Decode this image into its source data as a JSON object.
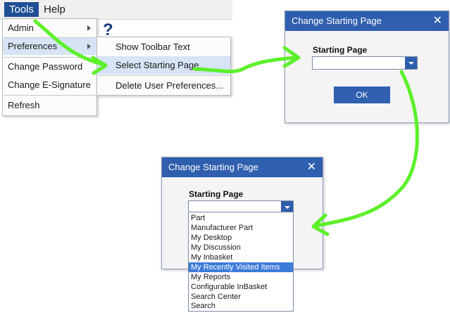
{
  "menubar": {
    "tools": "Tools",
    "help": "Help"
  },
  "toolbar": {
    "help_glyph": "?"
  },
  "tools_menu": {
    "items": [
      "Admin",
      "Preferences",
      "Change Password",
      "Change E-Signature",
      "Refresh"
    ]
  },
  "preferences_submenu": {
    "items": [
      "Show Toolbar Text",
      "Select Starting Page",
      "Delete User Preferences..."
    ]
  },
  "dialog_top": {
    "title": "Change Starting Page",
    "close": "✕",
    "label": "Starting Page",
    "value": "",
    "ok": "OK"
  },
  "dialog_bottom": {
    "title": "Change Starting Page",
    "close": "✕",
    "label": "Starting Page",
    "value": "",
    "options": [
      "Part",
      "Manufacturer Part",
      "My Desktop",
      "My Discussion",
      "My Inbasket",
      "My Recently Visited Items",
      "My Reports",
      "Configurable InBasket",
      "Search Center",
      "Search"
    ],
    "selected_option": "My Recently Visited Items"
  },
  "colors": {
    "accent": "#2f5fae",
    "menu_highlight": "#d6e4f5",
    "annotation_arrow": "#5cf02a"
  }
}
